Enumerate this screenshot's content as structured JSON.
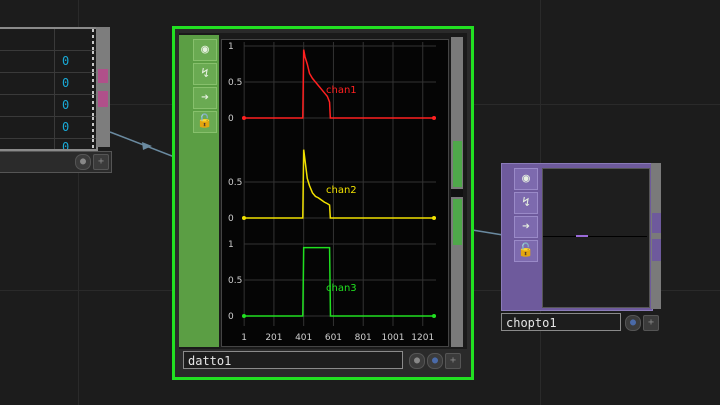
{
  "left_node": {
    "values": [
      "0",
      "0",
      "0",
      "0",
      "0"
    ]
  },
  "datto": {
    "name": "datto1",
    "tool_icons": [
      "viewer-icon",
      "bypass-icon",
      "cook-arrow-icon",
      "lock-icon"
    ],
    "colors": {
      "border": "#22e022",
      "strip": "#5b9e44"
    }
  },
  "chopto": {
    "name": "chopto1",
    "colors": {
      "frame": "#6e5a9c"
    }
  },
  "chart_data": {
    "type": "line",
    "panels": [
      {
        "name": "chan1",
        "color": "#ff2020",
        "ylim": [
          0,
          1
        ],
        "yticks": [
          "1",
          "0.5",
          "0"
        ],
        "x": [
          0,
          380,
          395,
          401,
          410,
          425,
          440,
          460,
          480,
          500,
          520,
          540,
          560,
          575,
          580,
          585,
          1290
        ],
        "y": [
          0,
          0,
          0,
          0.95,
          0.85,
          0.75,
          0.62,
          0.55,
          0.5,
          0.45,
          0.4,
          0.35,
          0.3,
          0.22,
          0,
          0,
          0
        ]
      },
      {
        "name": "chan2",
        "color": "#f0e000",
        "ylim": [
          0,
          1
        ],
        "yticks": [
          "0.5",
          "0"
        ],
        "x": [
          0,
          380,
          395,
          401,
          410,
          425,
          440,
          460,
          480,
          500,
          520,
          540,
          560,
          575,
          580,
          585,
          1290
        ],
        "y": [
          0,
          0,
          0,
          0.95,
          0.8,
          0.55,
          0.45,
          0.35,
          0.3,
          0.28,
          0.25,
          0.22,
          0.2,
          0.18,
          0,
          0,
          0
        ]
      },
      {
        "name": "chan3",
        "color": "#20e020",
        "ylim": [
          0,
          1
        ],
        "yticks": [
          "1",
          "0.5",
          "0"
        ],
        "x": [
          0,
          395,
          401,
          575,
          581,
          1290
        ],
        "y": [
          0,
          0,
          0.95,
          0.95,
          0,
          0
        ]
      }
    ],
    "xlim": [
      0,
      1290
    ],
    "xticks": [
      "1",
      "201",
      "401",
      "601",
      "801",
      "1001",
      "1201"
    ],
    "grid": true
  }
}
